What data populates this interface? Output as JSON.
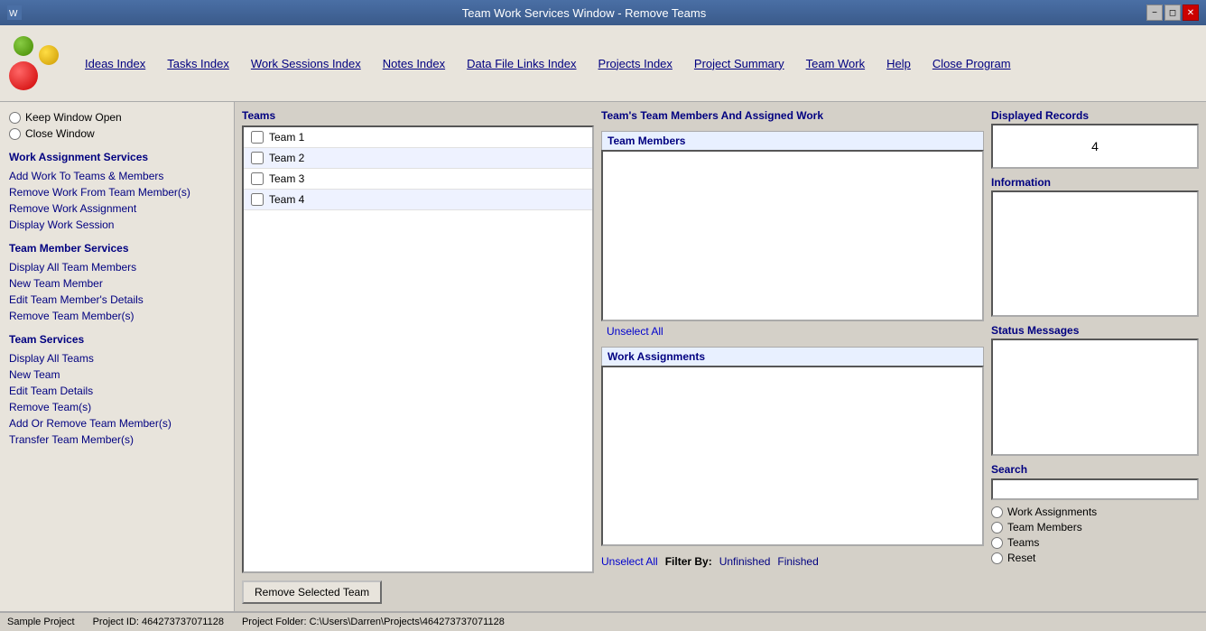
{
  "titleBar": {
    "title": "Team Work Services Window - Remove Teams",
    "iconAlt": "app-icon",
    "buttons": {
      "minimize": "−",
      "restore": "◻",
      "close": "✕"
    }
  },
  "menuBar": {
    "items": [
      {
        "id": "ideas-index",
        "label": "Ideas Index"
      },
      {
        "id": "tasks-index",
        "label": "Tasks Index"
      },
      {
        "id": "work-sessions-index",
        "label": "Work Sessions Index"
      },
      {
        "id": "notes-index",
        "label": "Notes Index"
      },
      {
        "id": "data-file-links-index",
        "label": "Data File Links Index"
      },
      {
        "id": "projects-index",
        "label": "Projects Index"
      },
      {
        "id": "project-summary",
        "label": "Project Summary"
      },
      {
        "id": "team-work",
        "label": "Team Work"
      },
      {
        "id": "help",
        "label": "Help"
      },
      {
        "id": "close-program",
        "label": "Close Program"
      }
    ]
  },
  "sidebar": {
    "windowOptions": {
      "keepOpen": "Keep Window Open",
      "closeWindow": "Close Window"
    },
    "workAssignmentServices": {
      "title": "Work Assignment Services",
      "links": [
        "Add Work To Teams & Members",
        "Remove Work From Team Member(s)",
        "Remove Work Assignment",
        "Display Work Session"
      ]
    },
    "teamMemberServices": {
      "title": "Team Member Services",
      "links": [
        "Display All Team Members",
        "New Team Member",
        "Edit Team Member's Details",
        "Remove Team Member(s)"
      ]
    },
    "teamServices": {
      "title": "Team Services",
      "links": [
        "Display All Teams",
        "New Team",
        "Edit Team Details",
        "Remove Team(s)",
        "Add Or Remove Team Member(s)",
        "Transfer Team Member(s)"
      ]
    }
  },
  "teamsPanel": {
    "header": "Teams",
    "teams": [
      {
        "id": 1,
        "label": "Team 1",
        "checked": false
      },
      {
        "id": 2,
        "label": "Team 2",
        "checked": false
      },
      {
        "id": 3,
        "label": "Team 3",
        "checked": false
      },
      {
        "id": 4,
        "label": "Team 4",
        "checked": false
      }
    ],
    "removeButton": "Remove Selected Team"
  },
  "teamDetailPanel": {
    "header": "Team's Team Members And Assigned Work",
    "teamMembersHeader": "Team Members",
    "unselectAll1": "Unselect All",
    "workAssignmentsHeader": "Work Assignments",
    "unselectAll2": "Unselect All",
    "filterBy": "Filter By:",
    "filterUnfinished": "Unfinished",
    "filterFinished": "Finished"
  },
  "rightPanel": {
    "displayedRecordsLabel": "Displayed Records",
    "displayedRecordsValue": "4",
    "informationLabel": "Information",
    "statusMessagesLabel": "Status Messages",
    "searchLabel": "Search",
    "searchPlaceholder": "",
    "searchOptions": [
      "Work Assignments",
      "Team Members",
      "Teams",
      "Reset"
    ]
  },
  "statusBar": {
    "project": "Sample Project",
    "projectIdLabel": "Project ID:",
    "projectId": "464273737071128",
    "projectFolderLabel": "Project Folder:",
    "projectFolder": "C:\\Users\\Darren\\Projects\\464273737071128"
  }
}
